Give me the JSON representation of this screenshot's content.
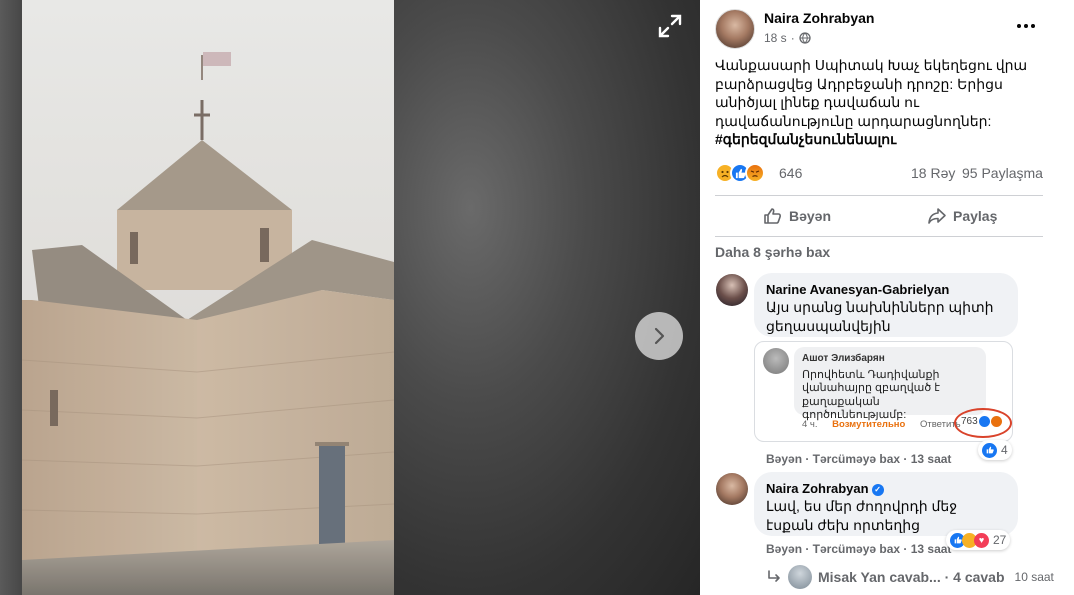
{
  "post": {
    "author": "Naira Zohrabyan",
    "time": "18 s",
    "privacy_icon": "globe-icon",
    "text": "Վանքասարի Սպիտակ Խաչ եկեղեցու վրա բարձրացվեց Ադրբեջանի դրոշը: Երիցս անիծյալ լինեք դավաճան ու դավաճանությունը արդարացնողներ:",
    "hashtag": "#գերեզմանչեսունենալու"
  },
  "stats": {
    "reaction_count": "646",
    "comments": "18 Rəy",
    "shares": "95 Paylaşma",
    "reaction_icons": [
      "sad-icon",
      "like-icon",
      "angry-icon"
    ]
  },
  "actions": {
    "like_label": "Bəyən",
    "share_label": "Paylaş"
  },
  "more_comments": "Daha 8 şərhə bax",
  "comments": [
    {
      "author": "Narine Avanesyan-Gabrielyan",
      "text": "Այս սրանց նախնիններր պիտի ցեղասպանվեյին",
      "actions": "Bəyən · Tərcüməyə bax · 13 saat",
      "reaction_count": "4"
    },
    {
      "author": "Naira Zohrabyan",
      "text": "Լավ, ես մեր ժողովրդի մեջ էսքան ժեխ որտեղից",
      "actions": "Bəyən · Tərcüməyə bax · 13 saat",
      "reaction_count": "27"
    }
  ],
  "embed": {
    "author": "Ашот Элизбарян",
    "text": "Որովհետև Դադիվանքի վանահայրը զբաղված է քաղաքական գործունեությամբ:",
    "time": "4 ч.",
    "reaction_label": "Возмутительно",
    "reply_label": "Ответить",
    "reaction_count": "763"
  },
  "reply": {
    "text": "Misak Yan cavab... · 4 cavab",
    "time": "10 saat"
  },
  "colors": {
    "accent": "#1877f2",
    "secondary_text": "#65676b",
    "comment_bg": "#f0f2f5"
  }
}
